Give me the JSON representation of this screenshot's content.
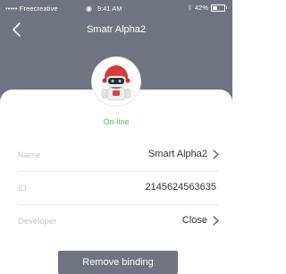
{
  "status_bar": {
    "carrier": "••••• Freecreative",
    "time": "9:41 AM",
    "battery": "42%",
    "battery_level": 0.42,
    "icons": [
      "wifi-icon",
      "bluetooth-icon",
      "battery-icon"
    ]
  },
  "nav": {
    "title": "Smatr Alpha2",
    "back_icon": "chevron-left-icon"
  },
  "device": {
    "avatar_icon": "robot-avatar",
    "status": "On-line",
    "status_color": "#5cb85c"
  },
  "details": [
    {
      "label": "Name",
      "value": "Smart Alpha2",
      "has_chevron": true
    },
    {
      "label": "ID",
      "value": "2145624563635",
      "has_chevron": false
    },
    {
      "label": "Developer",
      "value": "Close",
      "has_chevron": true
    }
  ],
  "actions": {
    "remove_label": "Remove binding"
  },
  "colors": {
    "header": "#6f7480",
    "online": "#5cb85c",
    "button": "#6f7480"
  }
}
